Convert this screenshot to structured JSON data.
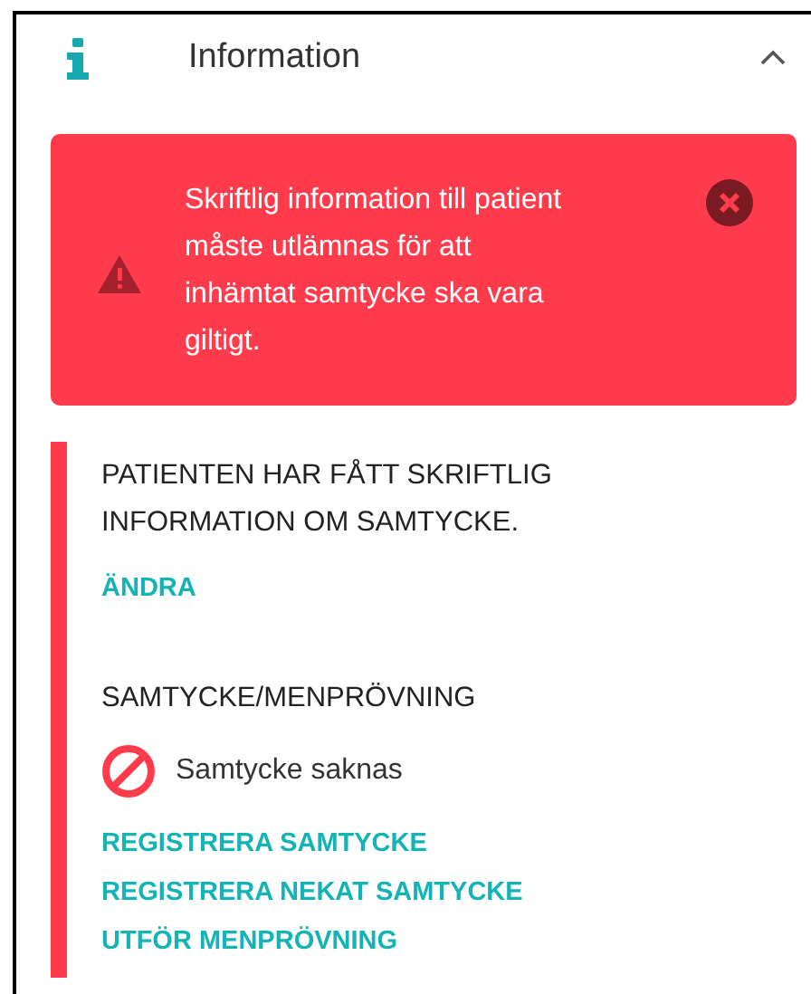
{
  "panel": {
    "title": "Information",
    "expanded": true
  },
  "alert": {
    "kind": "error",
    "message": "Skriftlig information till patient måste utlämnas för att inhämtat samtycke ska vara giltigt."
  },
  "sections": [
    {
      "heading": "PATIENTEN HAR FÅTT SKRIFTLIG INFORMATION OM SAMTYCKE.",
      "links": [
        "ÄNDRA"
      ]
    },
    {
      "heading": "SAMTYCKE/MENPRÖVNING",
      "status": {
        "kind": "missing",
        "text": "Samtycke saknas"
      },
      "links": [
        "REGISTRERA SAMTYCKE",
        "REGISTRERA NEKAT SAMTYCKE",
        "UTFÖR MENPRÖVNING"
      ]
    }
  ]
}
